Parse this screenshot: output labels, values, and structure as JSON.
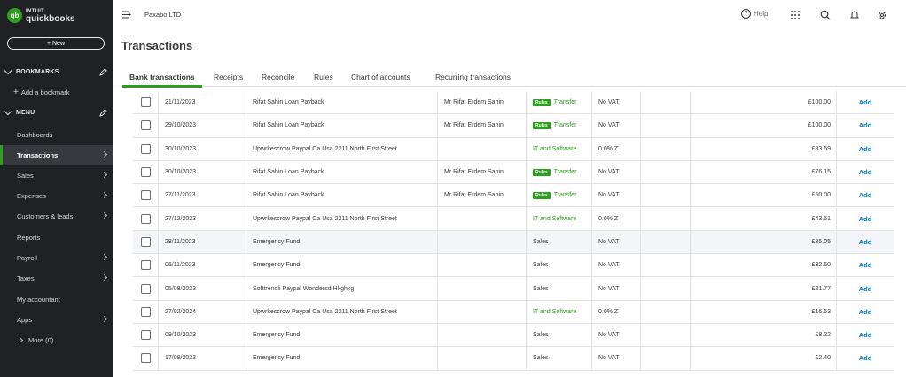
{
  "sidebar": {
    "logo_line1": "INTUIT",
    "logo_line2": "quickbooks",
    "logo_mark": "qb",
    "new_button": "+ New",
    "bookmarks_label": "BOOKMARKS",
    "add_bookmark": "Add a bookmark",
    "menu_label": "MENU",
    "items": [
      {
        "label": "Dashboards",
        "arrow": false,
        "active": false
      },
      {
        "label": "Transactions",
        "arrow": true,
        "active": true
      },
      {
        "label": "Sales",
        "arrow": true,
        "active": false
      },
      {
        "label": "Expenses",
        "arrow": true,
        "active": false
      },
      {
        "label": "Customers & leads",
        "arrow": true,
        "active": false
      },
      {
        "label": "Reports",
        "arrow": false,
        "active": false
      },
      {
        "label": "Payroll",
        "arrow": true,
        "active": false
      },
      {
        "label": "Taxes",
        "arrow": true,
        "active": false
      },
      {
        "label": "My accountant",
        "arrow": false,
        "active": false
      },
      {
        "label": "Apps",
        "arrow": true,
        "active": false
      }
    ],
    "more": "More (0)"
  },
  "topbar": {
    "company": "Paxabo LTD",
    "help": "Help",
    "icons": [
      "apps-grid-icon",
      "search-icon",
      "bell-icon",
      "gear-icon"
    ]
  },
  "page": {
    "title": "Transactions"
  },
  "tabs": [
    {
      "label": "Bank transactions",
      "active": true
    },
    {
      "label": "Receipts",
      "active": false
    },
    {
      "label": "Reconcile",
      "active": false
    },
    {
      "label": "Rules",
      "active": false
    },
    {
      "label": "Chart of accounts",
      "active": false
    },
    {
      "label": "Recurring transactions",
      "active": false
    }
  ],
  "rules_badge": "Rules",
  "colors": {
    "accent_green": "#2ca01c",
    "link_blue": "#0077c5",
    "sidebar_bg": "#1f2124"
  },
  "transactions": [
    {
      "date": "21/11/2023",
      "description": "Rifat Sahin Loan Payback",
      "payee": "Mr Rifat Erdem Sahin",
      "rule": true,
      "category": "Transfer",
      "category_green": true,
      "vat": "No VAT",
      "amount": "£100.00",
      "action": "Add"
    },
    {
      "date": "29/10/2023",
      "description": "Rifat Sahin Loan Payback",
      "payee": "Mr Rifat Erdem Sahin",
      "rule": true,
      "category": "Transfer",
      "category_green": true,
      "vat": "No VAT",
      "amount": "£100.00",
      "action": "Add"
    },
    {
      "date": "30/10/2023",
      "description": "Upwrkescrow Paypal Ca Usa 2211 North First Street",
      "payee": "",
      "rule": false,
      "category": "IT and Software",
      "category_green": true,
      "vat": "0.0% Z",
      "amount": "£83.59",
      "action": "Add"
    },
    {
      "date": "30/10/2023",
      "description": "Rifat Sahin Loan Payback",
      "payee": "Mr Rifat Erdem Sahin",
      "rule": true,
      "category": "Transfer",
      "category_green": true,
      "vat": "No VAT",
      "amount": "£76.15",
      "action": "Add"
    },
    {
      "date": "27/11/2023",
      "description": "Rifat Sahin Loan Payback",
      "payee": "Mr Rifat Erdem Sahin",
      "rule": true,
      "category": "Transfer",
      "category_green": true,
      "vat": "No VAT",
      "amount": "£50.00",
      "action": "Add"
    },
    {
      "date": "27/12/2023",
      "description": "Upwrkescrow Paypal Ca Usa 2211 North First Street",
      "payee": "",
      "rule": false,
      "category": "IT and Software",
      "category_green": true,
      "vat": "0.0% Z",
      "amount": "£43.51",
      "action": "Add"
    },
    {
      "date": "28/11/2023",
      "description": "Emergency Fund",
      "payee": "",
      "rule": false,
      "category": "Sales",
      "category_green": false,
      "vat": "No VAT",
      "amount": "£35.05",
      "action": "Add"
    },
    {
      "date": "06/11/2023",
      "description": "Emergency Fund",
      "payee": "",
      "rule": false,
      "category": "Sales",
      "category_green": false,
      "vat": "No VAT",
      "amount": "£32.50",
      "action": "Add"
    },
    {
      "date": "05/08/2023",
      "description": "Softtrendli Paypal Wondersd Hkghkg",
      "payee": "",
      "rule": false,
      "category": "Sales",
      "category_green": false,
      "vat": "No VAT",
      "amount": "£21.77",
      "action": "Add"
    },
    {
      "date": "27/02/2024",
      "description": "Upwrkescrow Paypal Ca Usa 2211 North First Street",
      "payee": "",
      "rule": false,
      "category": "IT and Software",
      "category_green": true,
      "vat": "0.0% Z",
      "amount": "£16.53",
      "action": "Add"
    },
    {
      "date": "09/10/2023",
      "description": "Emergency Fund",
      "payee": "",
      "rule": false,
      "category": "Sales",
      "category_green": false,
      "vat": "No VAT",
      "amount": "£8.22",
      "action": "Add"
    },
    {
      "date": "17/09/2023",
      "description": "Emergency Fund",
      "payee": "",
      "rule": false,
      "category": "Sales",
      "category_green": false,
      "vat": "No VAT",
      "amount": "£2.40",
      "action": "Add"
    }
  ]
}
